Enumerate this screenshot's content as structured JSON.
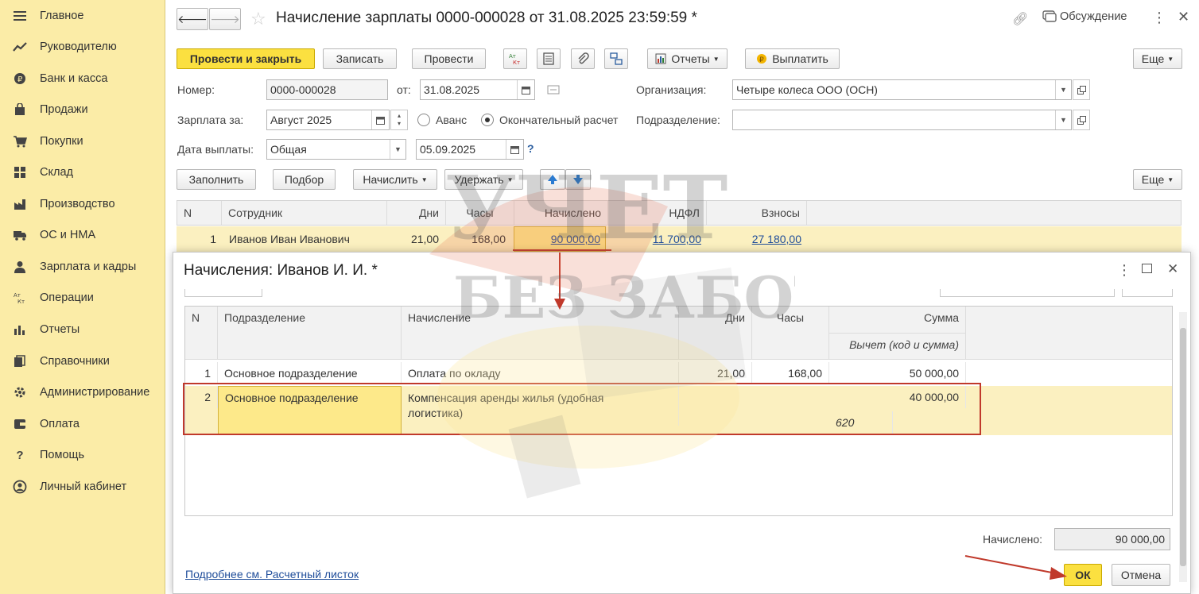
{
  "sidebar": {
    "items": [
      {
        "label": "Главное",
        "icon": "menu-icon"
      },
      {
        "label": "Руководителю",
        "icon": "trend-icon"
      },
      {
        "label": "Банк и касса",
        "icon": "coin-icon"
      },
      {
        "label": "Продажи",
        "icon": "bag-icon"
      },
      {
        "label": "Покупки",
        "icon": "cart-icon"
      },
      {
        "label": "Склад",
        "icon": "grid-icon"
      },
      {
        "label": "Производство",
        "icon": "factory-icon"
      },
      {
        "label": "ОС и НМА",
        "icon": "truck-icon"
      },
      {
        "label": "Зарплата и кадры",
        "icon": "person-icon"
      },
      {
        "label": "Операции",
        "icon": "dt-kt-icon"
      },
      {
        "label": "Отчеты",
        "icon": "bar-chart-icon"
      },
      {
        "label": "Справочники",
        "icon": "books-icon"
      },
      {
        "label": "Администрирование",
        "icon": "gear-icon"
      },
      {
        "label": "Оплата",
        "icon": "wallet-icon"
      },
      {
        "label": "Помощь",
        "icon": "question-icon"
      },
      {
        "label": "Личный кабинет",
        "icon": "user-circle-icon"
      }
    ]
  },
  "header": {
    "title": "Начисление зарплаты 0000-000028 от 31.08.2025 23:59:59 *",
    "discussion": "Обсуждение"
  },
  "toolbar": {
    "post_close": "Провести и закрыть",
    "save": "Записать",
    "post": "Провести",
    "dtkt": "Дт Кт",
    "reports": "Отчеты",
    "pay": "Выплатить",
    "more": "Еще"
  },
  "form": {
    "number_label": "Номер:",
    "number": "0000-000028",
    "from_label": "от:",
    "date": "31.08.2025",
    "org_label": "Организация:",
    "org": "Четыре колеса ООО (ОСН)",
    "salary_for_label": "Зарплата за:",
    "salary_for": "Август 2025",
    "advance": "Аванс",
    "final": "Окончательный расчет",
    "dept_label": "Подразделение:",
    "dept": "",
    "paydate_label": "Дата выплаты:",
    "paydate_type": "Общая",
    "paydate": "05.09.2025",
    "help": "?"
  },
  "grid_toolbar": {
    "fill": "Заполнить",
    "pick": "Подбор",
    "accrue": "Начислить",
    "withhold": "Удержать",
    "more": "Еще"
  },
  "grid": {
    "headers": [
      "N",
      "Сотрудник",
      "Дни",
      "Часы",
      "Начислено",
      "НДФЛ",
      "Взносы"
    ],
    "row": {
      "n": "1",
      "employee": "Иванов Иван Иванович",
      "days": "21,00",
      "hours": "168,00",
      "accrued": "90 000,00",
      "ndfl": "11 700,00",
      "contrib": "27 180,00"
    }
  },
  "dialog": {
    "title": "Начисления: Иванов И. И. *",
    "headers": {
      "n": "N",
      "dept": "Подразделение",
      "accrual": "Начисление",
      "days": "Дни",
      "hours": "Часы",
      "sum": "Сумма",
      "deduction": "Вычет (код и сумма)"
    },
    "rows": [
      {
        "n": "1",
        "dept": "Основное подразделение",
        "accrual": "Оплата по окладу",
        "days": "21,00",
        "hours": "168,00",
        "sum": "50 000,00",
        "code": ""
      },
      {
        "n": "2",
        "dept": "Основное подразделение",
        "accrual_line1": "Компенсация аренды жилья (удобная",
        "accrual_line2": "логистика)",
        "days": "",
        "hours": "",
        "sum": "40 000,00",
        "code": "620"
      }
    ],
    "total_label": "Начислено:",
    "total": "90 000,00",
    "link": "Подробнее см. Расчетный листок",
    "ok": "ОК",
    "cancel": "Отмена"
  },
  "watermark": {
    "line1": "УЧЕТ",
    "line2": "БЕЗ ЗАБОТ"
  },
  "colors": {
    "accent": "#fbe040",
    "sidebar": "#fbeca7",
    "highlight": "#c0392b",
    "link": "#1f4d9a"
  }
}
